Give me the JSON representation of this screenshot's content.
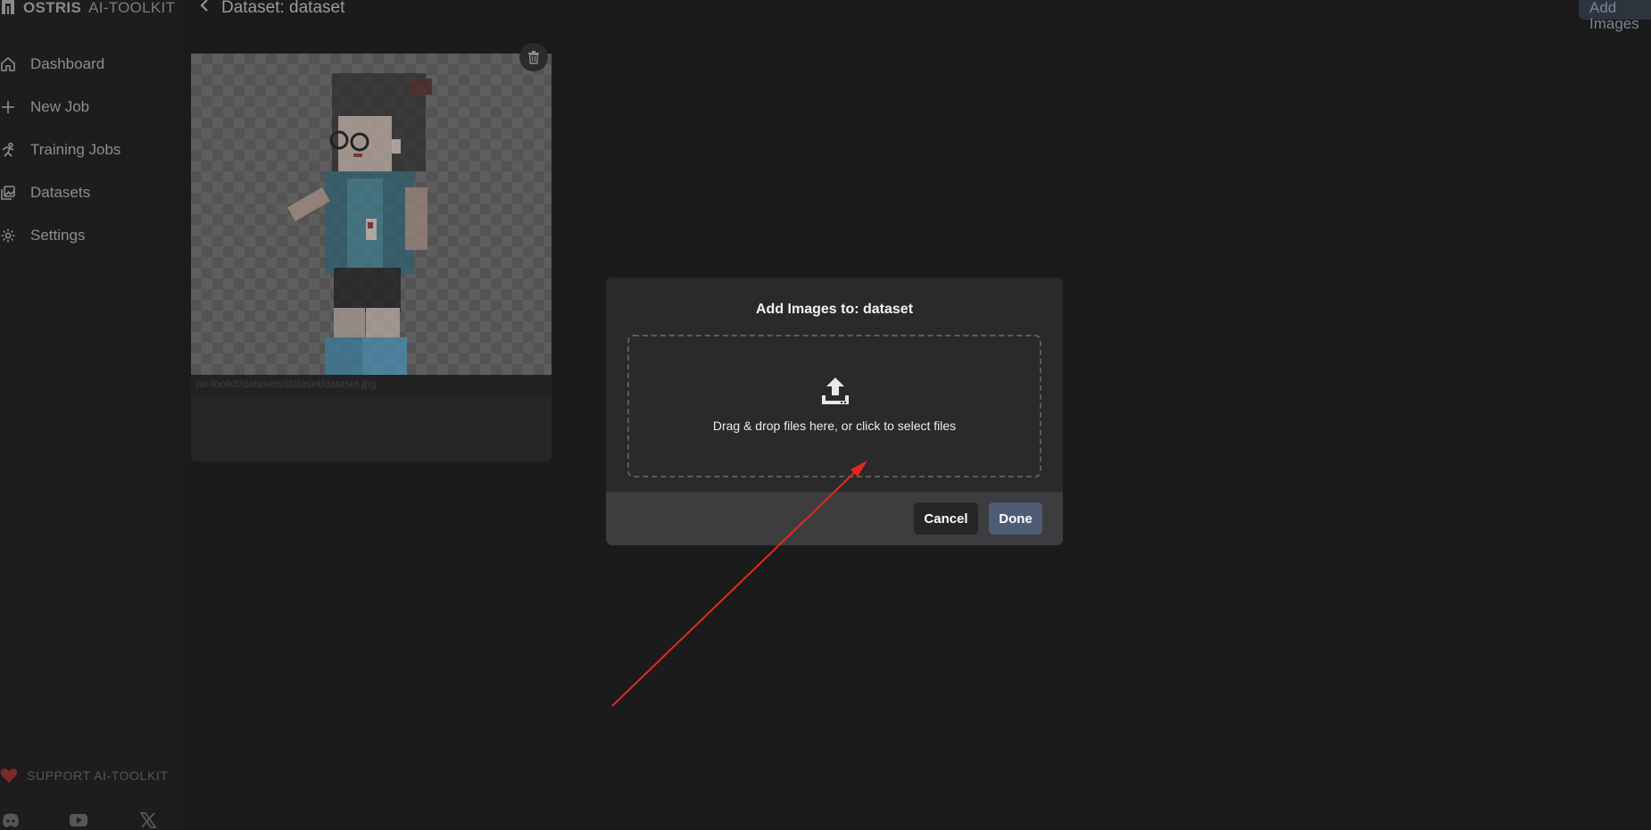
{
  "app": {
    "brand_bold": "OSTRIS",
    "brand_rest": "AI-TOOLKIT"
  },
  "sidebar": {
    "items": [
      {
        "label": "Dashboard",
        "icon": "home-icon"
      },
      {
        "label": "New Job",
        "icon": "plus-icon"
      },
      {
        "label": "Training Jobs",
        "icon": "training-icon"
      },
      {
        "label": "Datasets",
        "icon": "images-icon"
      },
      {
        "label": "Settings",
        "icon": "gear-icon"
      }
    ],
    "support_label": "SUPPORT AI-TOOLKIT",
    "socials": [
      "discord-icon",
      "youtube-icon",
      "x-icon"
    ]
  },
  "header": {
    "title": "Dataset: dataset",
    "add_images_label": "Add Images"
  },
  "card": {
    "image_path": "/ai-toolkit/datasets/dataset/dataset.jpg"
  },
  "modal": {
    "title": "Add Images to: dataset",
    "dropzone_text": "Drag & drop files here, or click to select files",
    "cancel_label": "Cancel",
    "done_label": "Done"
  },
  "colors": {
    "background": "#1b1b1c",
    "modal": "#2a2a2b",
    "modal_footer": "#3d3d3f",
    "done_button": "#4e5c76",
    "annotation_arrow": "#e5281e"
  }
}
